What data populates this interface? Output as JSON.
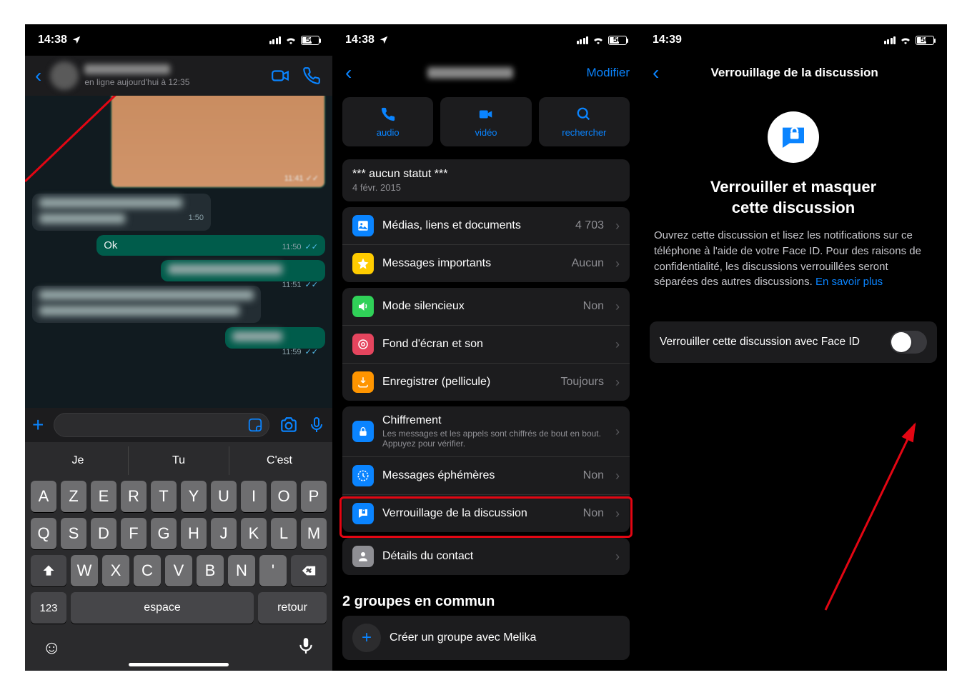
{
  "statusbar": {
    "time1": "14:38",
    "time2": "14:38",
    "time3": "14:39",
    "battery": "50"
  },
  "chat": {
    "last_seen": "en ligne aujourd'hui à 12:35",
    "video_time": "11:41",
    "msg_in1_time": "1:50",
    "msg_ok": "Ok",
    "msg_ok_time": "11:50",
    "msg_out2_time": "11:51",
    "msg_out3_time": "11:59",
    "sugg1": "Je",
    "sugg2": "Tu",
    "sugg3": "C'est",
    "key_123": "123",
    "key_space": "espace",
    "key_return": "retour"
  },
  "info": {
    "modifier": "Modifier",
    "btn_audio": "audio",
    "btn_video": "vidéo",
    "btn_search": "rechercher",
    "status_text": "*** aucun statut ***",
    "status_date": "4 févr. 2015",
    "media_label": "Médias, liens et documents",
    "media_count": "4 703",
    "starred_label": "Messages importants",
    "starred_val": "Aucun",
    "mute_label": "Mode silencieux",
    "mute_val": "Non",
    "wallpaper_label": "Fond d'écran et son",
    "save_label": "Enregistrer (pellicule)",
    "save_val": "Toujours",
    "encrypt_label": "Chiffrement",
    "encrypt_sub": "Les messages et les appels sont chiffrés de bout en bout. Appuyez pour vérifier.",
    "ephemeral_label": "Messages éphémères",
    "ephemeral_val": "Non",
    "lock_label": "Verrouillage de la discussion",
    "lock_val": "Non",
    "contact_details": "Détails du contact",
    "groups_title": "2 groupes en commun",
    "create_group": "Créer un groupe avec Melika"
  },
  "lock": {
    "header": "Verrouillage de la discussion",
    "title_line1": "Verrouiller et masquer",
    "title_line2": "cette discussion",
    "desc": "Ouvrez cette discussion et lisez les notifications sur ce téléphone à l'aide de votre Face ID. Pour des raisons de confidentialité, les discussions verrouillées seront séparées des autres discussions. ",
    "learn_more": "En savoir plus",
    "toggle_label": "Verrouiller cette discussion avec Face ID"
  }
}
